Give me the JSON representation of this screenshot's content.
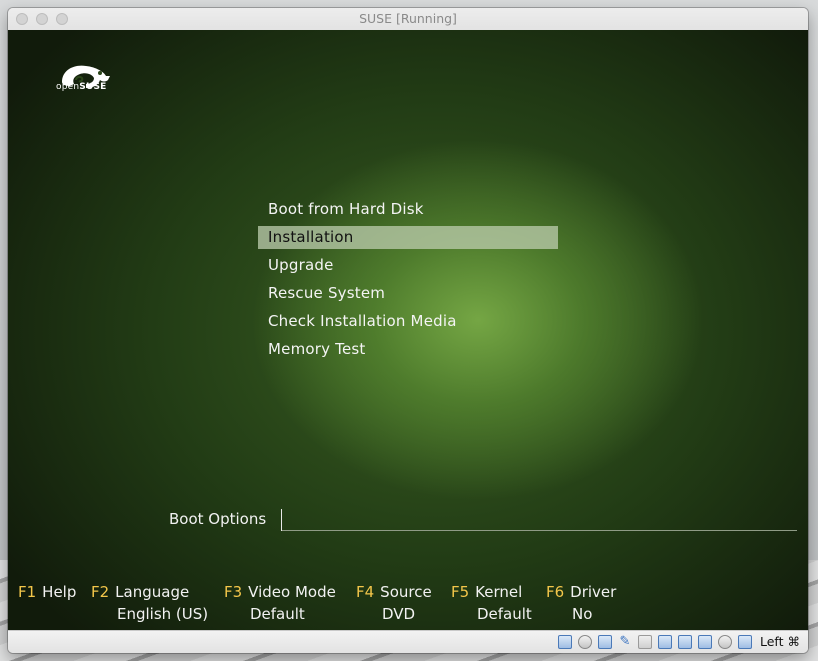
{
  "window": {
    "title": "SUSE [Running]"
  },
  "logo": {
    "prefix": "open",
    "brand": "SUSE"
  },
  "boot_menu": {
    "items": [
      {
        "label": "Boot from Hard Disk",
        "selected": false
      },
      {
        "label": "Installation",
        "selected": true
      },
      {
        "label": "Upgrade",
        "selected": false
      },
      {
        "label": "Rescue System",
        "selected": false
      },
      {
        "label": "Check Installation Media",
        "selected": false
      },
      {
        "label": "Memory Test",
        "selected": false
      }
    ]
  },
  "boot_options": {
    "label": "Boot Options",
    "value": ""
  },
  "function_keys": [
    {
      "key": "F1",
      "label": "Help",
      "value": ""
    },
    {
      "key": "F2",
      "label": "Language",
      "value": "English (US)"
    },
    {
      "key": "F3",
      "label": "Video Mode",
      "value": "Default"
    },
    {
      "key": "F4",
      "label": "Source",
      "value": "DVD"
    },
    {
      "key": "F5",
      "label": "Kernel",
      "value": "Default"
    },
    {
      "key": "F6",
      "label": "Driver",
      "value": "No"
    }
  ],
  "statusbar": {
    "icons": [
      "hard-disk-icon",
      "optical-drive-icon",
      "audio-icon",
      "usb-icon",
      "shared-folder-icon",
      "display-icon",
      "network-icon",
      "video-capture-icon",
      "recording-icon",
      "cpu-icon",
      "mouse-integration-icon"
    ],
    "host_key": "Left ⌘"
  },
  "colors": {
    "fkey_accent": "#f3c64a",
    "selection": "#bfcdaf"
  }
}
